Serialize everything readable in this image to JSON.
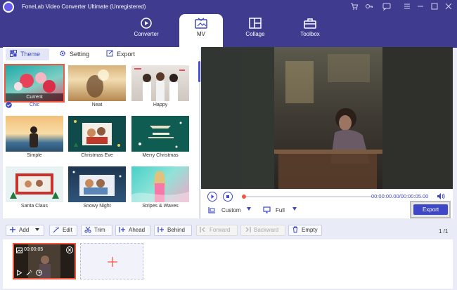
{
  "window": {
    "title": "FoneLab Video Converter Ultimate (Unregistered)",
    "controls": [
      "cart-icon",
      "key-icon",
      "chat-icon",
      "menu-icon",
      "minimize-icon",
      "maximize-icon",
      "close-icon"
    ]
  },
  "main_tabs": [
    {
      "label": "Converter",
      "icon": "converter-icon"
    },
    {
      "label": "MV",
      "icon": "mv-icon",
      "active": true
    },
    {
      "label": "Collage",
      "icon": "collage-icon"
    },
    {
      "label": "Toolbox",
      "icon": "toolbox-icon"
    }
  ],
  "sub_tabs": [
    {
      "label": "Theme",
      "icon": "theme-icon",
      "active": true
    },
    {
      "label": "Setting",
      "icon": "gear-icon"
    },
    {
      "label": "Export",
      "icon": "export-icon"
    }
  ],
  "themes": [
    {
      "name": "Chic",
      "selected": true,
      "badge": "Current"
    },
    {
      "name": "Neat"
    },
    {
      "name": "Happy"
    },
    {
      "name": "Simple"
    },
    {
      "name": "Christmas Eve"
    },
    {
      "name": "Merry Christmas"
    },
    {
      "name": "Santa Claus"
    },
    {
      "name": "Snowy Night"
    },
    {
      "name": "Stripes & Waves"
    }
  ],
  "player": {
    "time": "00:00:00.00/00:00:05.00",
    "aspect_label": "Custom",
    "display_label": "Full",
    "export_label": "Export"
  },
  "toolbar": {
    "add": "Add",
    "edit": "Edit",
    "trim": "Trim",
    "ahead": "Ahead",
    "behind": "Behind",
    "forward": "Forward",
    "backward": "Backward",
    "empty": "Empty",
    "page": "1 /1"
  },
  "timeline": {
    "clip_time": "00:00:05"
  },
  "colors": {
    "accent": "#3e47c5",
    "topbar": "#3f3b8f",
    "highlight": "#f2573f"
  }
}
